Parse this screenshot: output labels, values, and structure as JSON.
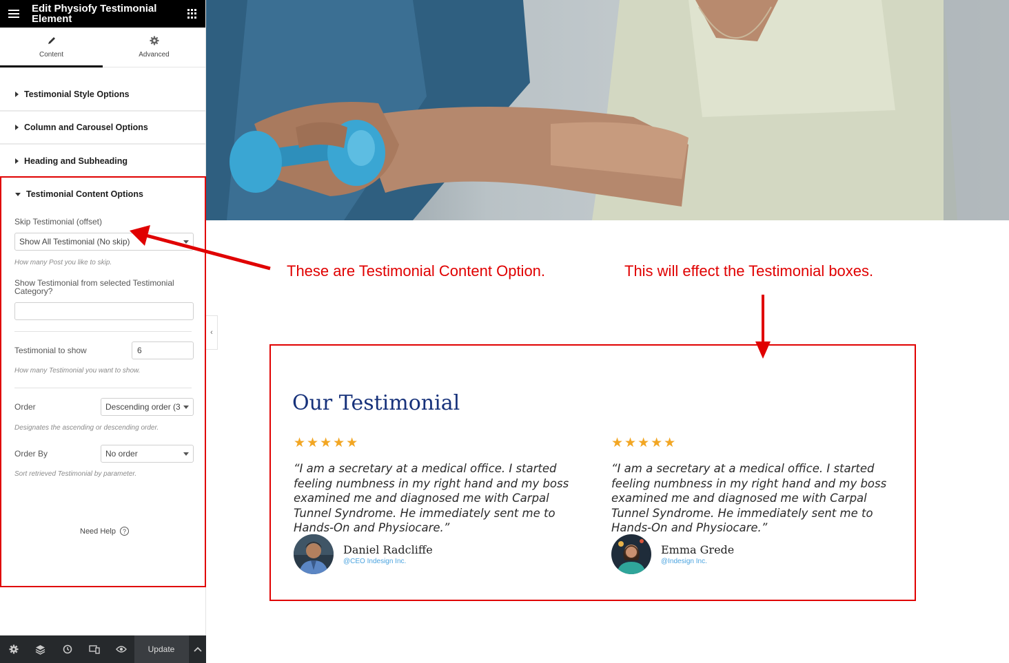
{
  "sidebar": {
    "title": "Edit Physiofy Testimonial Element",
    "tabs": [
      {
        "label": "Content",
        "icon": "pencil-icon",
        "active": true
      },
      {
        "label": "Advanced",
        "icon": "gear-icon",
        "active": false
      }
    ],
    "sections": [
      {
        "label": "Testimonial Style Options"
      },
      {
        "label": "Column and Carousel Options"
      },
      {
        "label": "Heading and Subheading"
      },
      {
        "label": "Testimonial Content Options"
      }
    ],
    "controls": {
      "skip": {
        "label": "Skip Testimonial (offset)",
        "value": "Show All Testimonial (No skip)",
        "note": "How many Post you like to skip."
      },
      "category": {
        "label": "Show Testimonial from selected Testimonial Category?",
        "value": ""
      },
      "count": {
        "label": "Testimonial to show",
        "value": "6",
        "note": "How many Testimonial you want to show."
      },
      "order": {
        "label": "Order",
        "value": "Descending order (3",
        "note": "Designates the ascending or descending order."
      },
      "orderby": {
        "label": "Order By",
        "value": "No order",
        "note": "Sort retrieved Testimonial by parameter."
      }
    },
    "need_help": "Need Help",
    "footer": {
      "update_label": "Update"
    }
  },
  "annotations": {
    "left": "These are Testimonial Content Option.",
    "right": "This will effect the Testimonial boxes.",
    "color": "#e00000"
  },
  "testimonial": {
    "title": "Our Testimonial",
    "stars": "★★★★★",
    "rating": 5,
    "items": [
      {
        "quote": "“I am a secretary at a medical office. I started feeling numbness in my right hand and my boss examined me and diagnosed me with Carpal Tunnel Syndrome. He immediately sent me to Hands-On and Physiocare.”",
        "name": "Daniel Radcliffe",
        "role": "@CEO Indesign Inc."
      },
      {
        "quote": "“I am a secretary at a medical office. I started feeling numbness in my right hand and my boss examined me and diagnosed me with Carpal Tunnel Syndrome. He immediately sent me to Hands-On and Physiocare.”",
        "name": "Emma Grede",
        "role": "@Indesign Inc."
      }
    ]
  },
  "colors": {
    "title": "#16317a",
    "star": "#f2a623",
    "role": "#4aa3df",
    "dumbbell": "#3aa6d3"
  }
}
